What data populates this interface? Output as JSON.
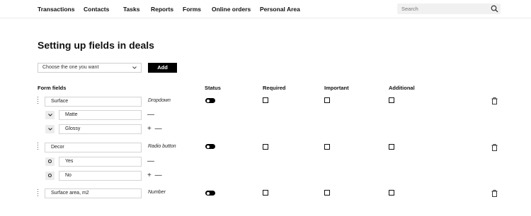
{
  "nav": {
    "items": [
      "Transactions",
      "Contacts",
      "Tasks",
      "Reports",
      "Forms",
      "Online orders",
      "Personal Area"
    ]
  },
  "search": {
    "placeholder": "Search"
  },
  "page": {
    "title": "Setting up fields in deals"
  },
  "toolbar": {
    "select_value": "Choose the one you want",
    "add_label": "Add"
  },
  "table": {
    "columns": [
      "Form fields",
      "Status",
      "Required",
      "Important",
      "Additional"
    ],
    "fields": [
      {
        "name": "Surface",
        "type": "Dropdown",
        "status_on": true,
        "required": false,
        "important": false,
        "additional": false,
        "options": [
          "Matte",
          "Glossy"
        ]
      },
      {
        "name": "Decor",
        "type": "Radio button",
        "status_on": true,
        "required": false,
        "important": false,
        "additional": false,
        "options": [
          "Yes",
          "No"
        ]
      },
      {
        "name": "Surface area, m2",
        "type": "Number",
        "status_on": true,
        "required": false,
        "important": false,
        "additional": false,
        "options": []
      }
    ],
    "option_marker": "O",
    "remove_sign": "—",
    "add_remove_sign": "+ —"
  },
  "colors": {
    "accent": "#000000",
    "input_border": "#d4d4d4",
    "search_bg": "#f1f1f1"
  }
}
